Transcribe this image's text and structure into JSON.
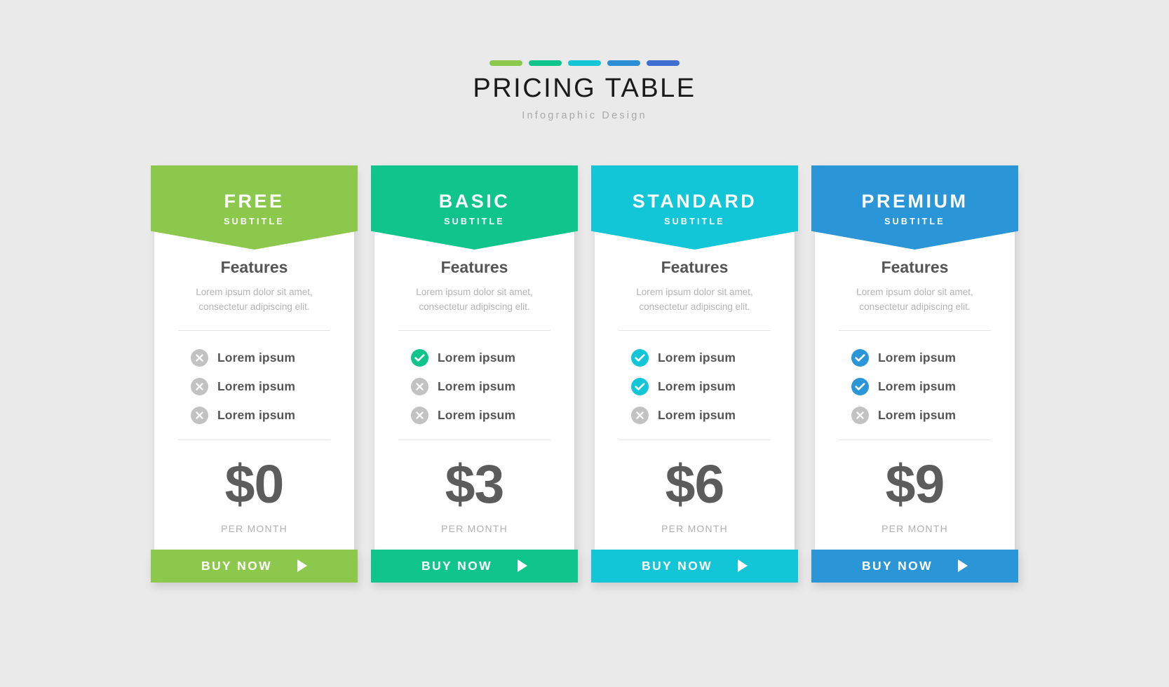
{
  "header": {
    "title": "PRICING TABLE",
    "subtitle": "Infographic Design",
    "accent_bars": [
      "#8cc84b",
      "#0fc58c",
      "#12c6d8",
      "#2a8fd4",
      "#3f6fd0"
    ]
  },
  "plans": [
    {
      "name": "FREE",
      "subtitle": "SUBTITLE",
      "color": "#8cc84b",
      "features_heading": "Features",
      "features_desc": "Lorem ipsum dolor sit amet, consectetur adipiscing elit.",
      "features": [
        {
          "label": "Lorem ipsum",
          "state": "off",
          "icon": "x-circle-icon"
        },
        {
          "label": "Lorem ipsum",
          "state": "off",
          "icon": "x-circle-icon"
        },
        {
          "label": "Lorem ipsum",
          "state": "off",
          "icon": "x-circle-icon"
        }
      ],
      "price": "$0",
      "period": "PER MONTH",
      "cta_label": "BUY NOW",
      "cta_icon": "play-arrow-icon"
    },
    {
      "name": "BASIC",
      "subtitle": "SUBTITLE",
      "color": "#0fc58c",
      "features_heading": "Features",
      "features_desc": "Lorem ipsum dolor sit amet, consectetur adipiscing elit.",
      "features": [
        {
          "label": "Lorem ipsum",
          "state": "on",
          "icon": "check-circle-icon"
        },
        {
          "label": "Lorem ipsum",
          "state": "off",
          "icon": "x-circle-icon"
        },
        {
          "label": "Lorem ipsum",
          "state": "off",
          "icon": "x-circle-icon"
        }
      ],
      "price": "$3",
      "period": "PER MONTH",
      "cta_label": "BUY NOW",
      "cta_icon": "play-arrow-icon"
    },
    {
      "name": "STANDARD",
      "subtitle": "SUBTITLE",
      "color": "#12c6d8",
      "features_heading": "Features",
      "features_desc": "Lorem ipsum dolor sit amet, consectetur adipiscing elit.",
      "features": [
        {
          "label": "Lorem ipsum",
          "state": "on",
          "icon": "check-circle-icon"
        },
        {
          "label": "Lorem ipsum",
          "state": "on",
          "icon": "check-circle-icon"
        },
        {
          "label": "Lorem ipsum",
          "state": "off",
          "icon": "x-circle-icon"
        }
      ],
      "price": "$6",
      "period": "PER MONTH",
      "cta_label": "BUY NOW",
      "cta_icon": "play-arrow-icon"
    },
    {
      "name": "PREMIUM",
      "subtitle": "SUBTITLE",
      "color": "#2a96d8",
      "features_heading": "Features",
      "features_desc": "Lorem ipsum dolor sit amet, consectetur adipiscing elit.",
      "features": [
        {
          "label": "Lorem ipsum",
          "state": "on",
          "icon": "check-circle-icon"
        },
        {
          "label": "Lorem ipsum",
          "state": "on",
          "icon": "check-circle-icon"
        },
        {
          "label": "Lorem ipsum",
          "state": "off",
          "icon": "x-circle-icon"
        }
      ],
      "price": "$9",
      "period": "PER MONTH",
      "cta_label": "BUY NOW",
      "cta_icon": "play-arrow-icon"
    }
  ],
  "palette": {
    "background": "#eaeaea",
    "card_background": "#ffffff",
    "disabled_icon": "#c2c2c2",
    "price_text": "#5c5c5c",
    "muted_text": "#b3b3b3"
  }
}
